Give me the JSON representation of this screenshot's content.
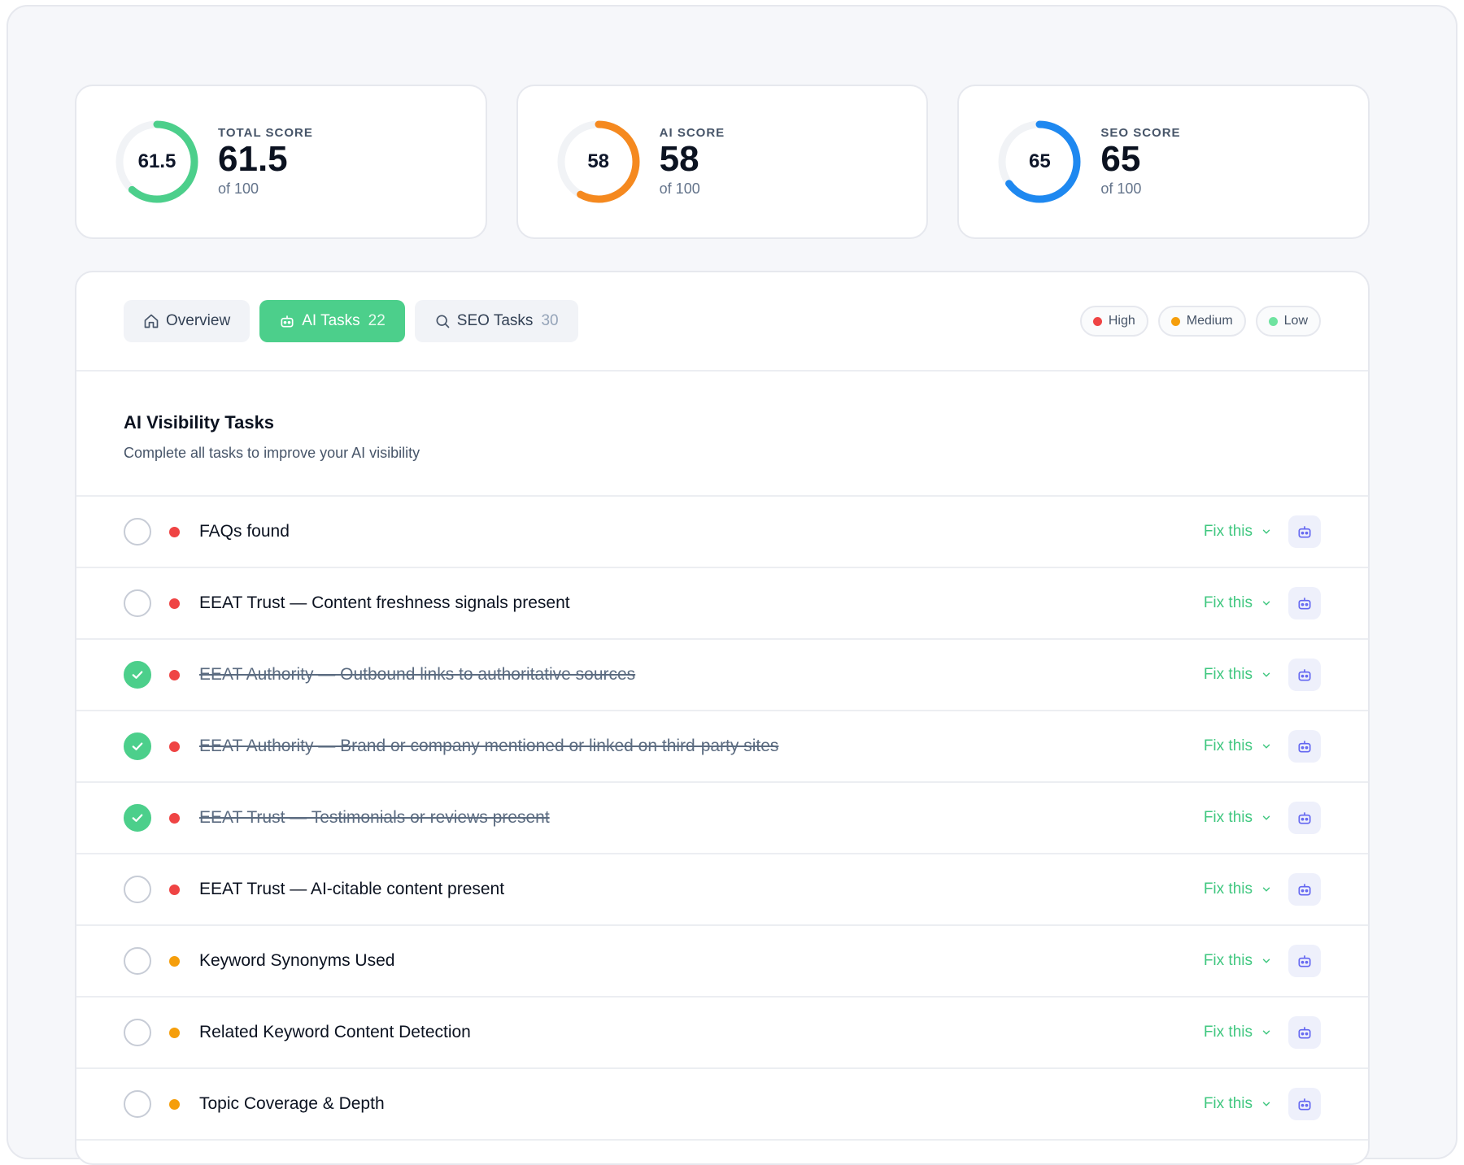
{
  "scores": [
    {
      "label": "TOTAL SCORE",
      "value": "61.5",
      "fraction": 0.615,
      "sub": "of 100",
      "color": "#4ccf8b"
    },
    {
      "label": "AI SCORE",
      "value": "58",
      "fraction": 0.58,
      "sub": "of 100",
      "color": "#f5891f"
    },
    {
      "label": "SEO SCORE",
      "value": "65",
      "fraction": 0.65,
      "sub": "of 100",
      "color": "#1e88f0"
    }
  ],
  "tabs": {
    "overview": {
      "label": "Overview"
    },
    "ai": {
      "label": "AI Tasks",
      "count": "22"
    },
    "seo": {
      "label": "SEO Tasks",
      "count": "30"
    }
  },
  "legend": {
    "high": {
      "label": "High",
      "color": "#ef4444"
    },
    "medium": {
      "label": "Medium",
      "color": "#f59e0b"
    },
    "low": {
      "label": "Low",
      "color": "#6fe3a0"
    }
  },
  "section": {
    "title": "AI Visibility Tasks",
    "subtitle": "Complete all tasks to improve your AI visibility"
  },
  "fix_label": "Fix this",
  "tasks": [
    {
      "name": "FAQs found",
      "priority": "high",
      "done": false
    },
    {
      "name": "EEAT Trust — Content freshness signals present",
      "priority": "high",
      "done": false
    },
    {
      "name": "EEAT Authority — Outbound links to authoritative sources",
      "priority": "high",
      "done": true
    },
    {
      "name": "EEAT Authority — Brand or company mentioned or linked on third-party sites",
      "priority": "high",
      "done": true
    },
    {
      "name": "EEAT Trust — Testimonials or reviews present",
      "priority": "high",
      "done": true
    },
    {
      "name": "EEAT Trust — AI-citable content present",
      "priority": "high",
      "done": false
    },
    {
      "name": "Keyword Synonyms Used",
      "priority": "medium",
      "done": false
    },
    {
      "name": "Related Keyword Content Detection",
      "priority": "medium",
      "done": false
    },
    {
      "name": "Topic Coverage & Depth",
      "priority": "medium",
      "done": false
    }
  ]
}
